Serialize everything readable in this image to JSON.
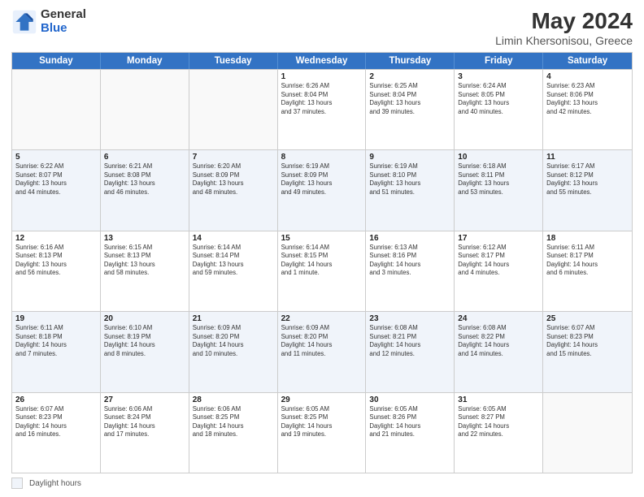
{
  "logo": {
    "general": "General",
    "blue": "Blue"
  },
  "header": {
    "title": "May 2024",
    "subtitle": "Limin Khersonisou, Greece"
  },
  "days_of_week": [
    "Sunday",
    "Monday",
    "Tuesday",
    "Wednesday",
    "Thursday",
    "Friday",
    "Saturday"
  ],
  "weeks": [
    {
      "cells": [
        {
          "day": "",
          "info": ""
        },
        {
          "day": "",
          "info": ""
        },
        {
          "day": "",
          "info": ""
        },
        {
          "day": "1",
          "info": "Sunrise: 6:26 AM\nSunset: 8:04 PM\nDaylight: 13 hours\nand 37 minutes."
        },
        {
          "day": "2",
          "info": "Sunrise: 6:25 AM\nSunset: 8:04 PM\nDaylight: 13 hours\nand 39 minutes."
        },
        {
          "day": "3",
          "info": "Sunrise: 6:24 AM\nSunset: 8:05 PM\nDaylight: 13 hours\nand 40 minutes."
        },
        {
          "day": "4",
          "info": "Sunrise: 6:23 AM\nSunset: 8:06 PM\nDaylight: 13 hours\nand 42 minutes."
        }
      ]
    },
    {
      "cells": [
        {
          "day": "5",
          "info": "Sunrise: 6:22 AM\nSunset: 8:07 PM\nDaylight: 13 hours\nand 44 minutes."
        },
        {
          "day": "6",
          "info": "Sunrise: 6:21 AM\nSunset: 8:08 PM\nDaylight: 13 hours\nand 46 minutes."
        },
        {
          "day": "7",
          "info": "Sunrise: 6:20 AM\nSunset: 8:09 PM\nDaylight: 13 hours\nand 48 minutes."
        },
        {
          "day": "8",
          "info": "Sunrise: 6:19 AM\nSunset: 8:09 PM\nDaylight: 13 hours\nand 49 minutes."
        },
        {
          "day": "9",
          "info": "Sunrise: 6:19 AM\nSunset: 8:10 PM\nDaylight: 13 hours\nand 51 minutes."
        },
        {
          "day": "10",
          "info": "Sunrise: 6:18 AM\nSunset: 8:11 PM\nDaylight: 13 hours\nand 53 minutes."
        },
        {
          "day": "11",
          "info": "Sunrise: 6:17 AM\nSunset: 8:12 PM\nDaylight: 13 hours\nand 55 minutes."
        }
      ]
    },
    {
      "cells": [
        {
          "day": "12",
          "info": "Sunrise: 6:16 AM\nSunset: 8:13 PM\nDaylight: 13 hours\nand 56 minutes."
        },
        {
          "day": "13",
          "info": "Sunrise: 6:15 AM\nSunset: 8:13 PM\nDaylight: 13 hours\nand 58 minutes."
        },
        {
          "day": "14",
          "info": "Sunrise: 6:14 AM\nSunset: 8:14 PM\nDaylight: 13 hours\nand 59 minutes."
        },
        {
          "day": "15",
          "info": "Sunrise: 6:14 AM\nSunset: 8:15 PM\nDaylight: 14 hours\nand 1 minute."
        },
        {
          "day": "16",
          "info": "Sunrise: 6:13 AM\nSunset: 8:16 PM\nDaylight: 14 hours\nand 3 minutes."
        },
        {
          "day": "17",
          "info": "Sunrise: 6:12 AM\nSunset: 8:17 PM\nDaylight: 14 hours\nand 4 minutes."
        },
        {
          "day": "18",
          "info": "Sunrise: 6:11 AM\nSunset: 8:17 PM\nDaylight: 14 hours\nand 6 minutes."
        }
      ]
    },
    {
      "cells": [
        {
          "day": "19",
          "info": "Sunrise: 6:11 AM\nSunset: 8:18 PM\nDaylight: 14 hours\nand 7 minutes."
        },
        {
          "day": "20",
          "info": "Sunrise: 6:10 AM\nSunset: 8:19 PM\nDaylight: 14 hours\nand 8 minutes."
        },
        {
          "day": "21",
          "info": "Sunrise: 6:09 AM\nSunset: 8:20 PM\nDaylight: 14 hours\nand 10 minutes."
        },
        {
          "day": "22",
          "info": "Sunrise: 6:09 AM\nSunset: 8:20 PM\nDaylight: 14 hours\nand 11 minutes."
        },
        {
          "day": "23",
          "info": "Sunrise: 6:08 AM\nSunset: 8:21 PM\nDaylight: 14 hours\nand 12 minutes."
        },
        {
          "day": "24",
          "info": "Sunrise: 6:08 AM\nSunset: 8:22 PM\nDaylight: 14 hours\nand 14 minutes."
        },
        {
          "day": "25",
          "info": "Sunrise: 6:07 AM\nSunset: 8:23 PM\nDaylight: 14 hours\nand 15 minutes."
        }
      ]
    },
    {
      "cells": [
        {
          "day": "26",
          "info": "Sunrise: 6:07 AM\nSunset: 8:23 PM\nDaylight: 14 hours\nand 16 minutes."
        },
        {
          "day": "27",
          "info": "Sunrise: 6:06 AM\nSunset: 8:24 PM\nDaylight: 14 hours\nand 17 minutes."
        },
        {
          "day": "28",
          "info": "Sunrise: 6:06 AM\nSunset: 8:25 PM\nDaylight: 14 hours\nand 18 minutes."
        },
        {
          "day": "29",
          "info": "Sunrise: 6:05 AM\nSunset: 8:25 PM\nDaylight: 14 hours\nand 19 minutes."
        },
        {
          "day": "30",
          "info": "Sunrise: 6:05 AM\nSunset: 8:26 PM\nDaylight: 14 hours\nand 21 minutes."
        },
        {
          "day": "31",
          "info": "Sunrise: 6:05 AM\nSunset: 8:27 PM\nDaylight: 14 hours\nand 22 minutes."
        },
        {
          "day": "",
          "info": ""
        }
      ]
    }
  ],
  "footer": {
    "legend_label": "Daylight hours"
  }
}
